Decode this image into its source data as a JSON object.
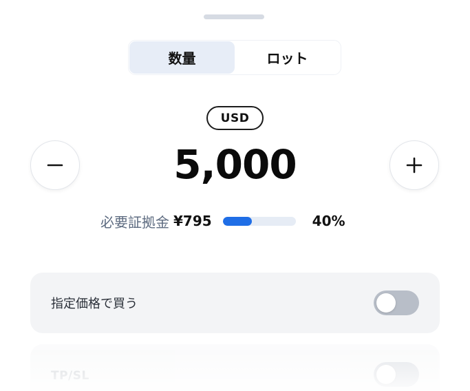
{
  "tabs": [
    {
      "label": "数量",
      "active": true
    },
    {
      "label": "ロット",
      "active": false
    }
  ],
  "currency": "USD",
  "amount": "5,000",
  "margin": {
    "label": "必要証拠金",
    "value": "¥795",
    "percent_label": "40%",
    "progress": 0.4
  },
  "limit_order": {
    "label": "指定価格で買う",
    "enabled": false
  },
  "tp_sl": {
    "label": "TP/SL",
    "enabled": false
  },
  "colors": {
    "accent": "#1f6ee6",
    "active_tab": "#e7edf7",
    "card": "#f3f4f6",
    "toggle_off": "#b8bec8"
  },
  "icons": {
    "minus": "minus-icon",
    "plus": "plus-icon"
  }
}
